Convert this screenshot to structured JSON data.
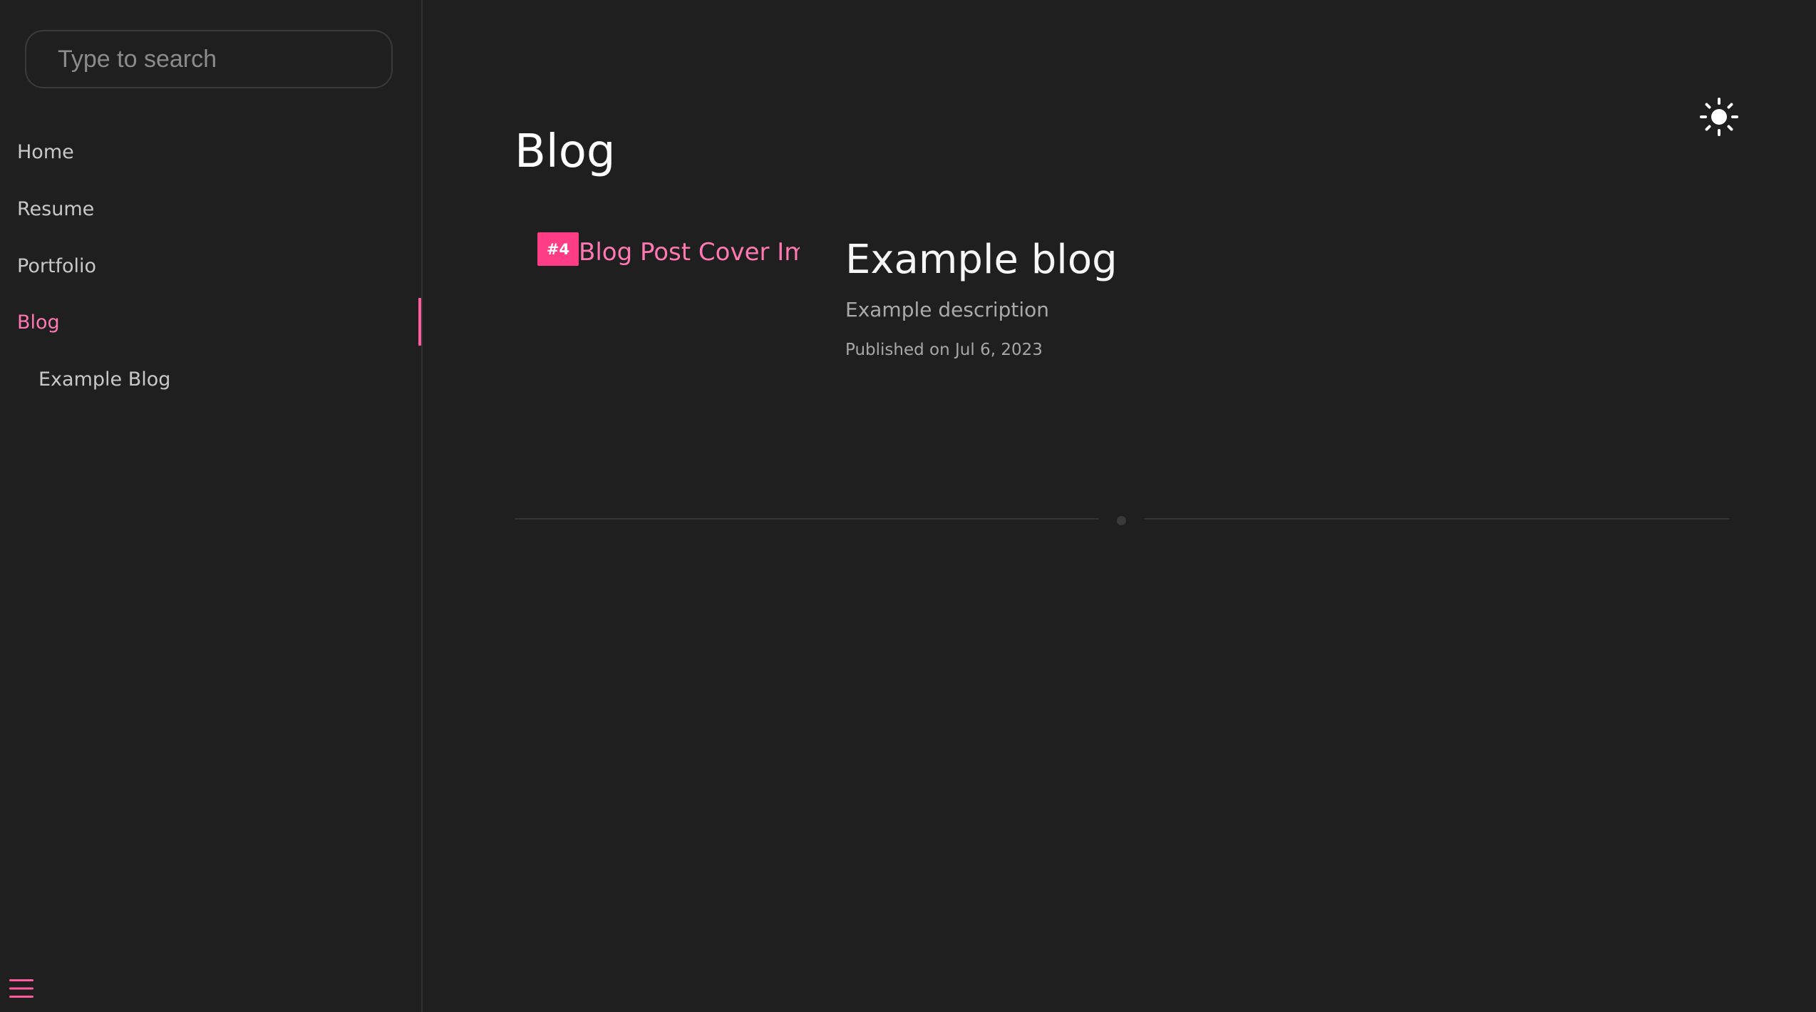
{
  "sidebar": {
    "search": {
      "placeholder": "Type to search",
      "value": ""
    },
    "nav": [
      {
        "label": "Home"
      },
      {
        "label": "Resume"
      },
      {
        "label": "Portfolio"
      },
      {
        "label": "Blog",
        "active": true
      },
      {
        "label": "Example Blog",
        "nested": true
      }
    ],
    "menu_icon": "hamburger-menu-icon"
  },
  "header": {
    "theme_toggle_icon": "sun-icon"
  },
  "main": {
    "title": "Blog",
    "posts": [
      {
        "cover_alt": "Blog Post Cover Image",
        "badge": "#4",
        "title": "Example blog",
        "description": "Example description",
        "published": "Published on Jul 6, 2023"
      }
    ]
  },
  "colors": {
    "background": "#1f1f1f",
    "accent": "#ff5b9e",
    "accent_text": "#ff78b3",
    "badge": "#ff3d86",
    "text_primary": "#ffffff",
    "text_secondary": "#aaaaaa"
  }
}
